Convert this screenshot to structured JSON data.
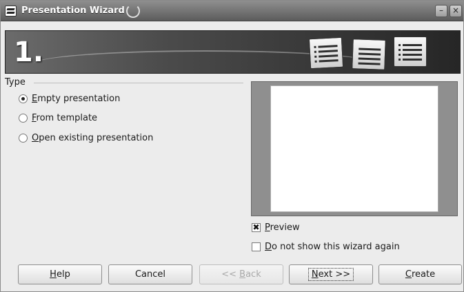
{
  "window": {
    "title": "Presentation Wizard",
    "minimize_glyph": "–",
    "close_glyph": "×"
  },
  "banner": {
    "step": "1."
  },
  "type_group": {
    "label": "Type",
    "options": [
      {
        "accel": "E",
        "rest": "mpty presentation",
        "selected": true
      },
      {
        "accel": "F",
        "rest": "rom template",
        "selected": false
      },
      {
        "accel": "O",
        "rest": "pen existing presentation",
        "selected": false
      }
    ]
  },
  "preview": {
    "checkbox": {
      "accel": "P",
      "rest": "review",
      "checked": true,
      "mark": "✖"
    },
    "dont_show": {
      "accel": "D",
      "rest": "o not show this wizard again",
      "checked": false
    }
  },
  "buttons": {
    "help": {
      "accel": "H",
      "rest": "elp"
    },
    "cancel": {
      "label": "Cancel"
    },
    "back": {
      "pre": "<< ",
      "accel": "B",
      "rest": "ack",
      "enabled": false
    },
    "next": {
      "accel": "N",
      "rest": "ext >>"
    },
    "create": {
      "accel": "C",
      "rest": "reate"
    }
  },
  "icons": [
    "app-icon",
    "window-minimize-icon",
    "window-close-icon",
    "presentation-slides-icon"
  ]
}
